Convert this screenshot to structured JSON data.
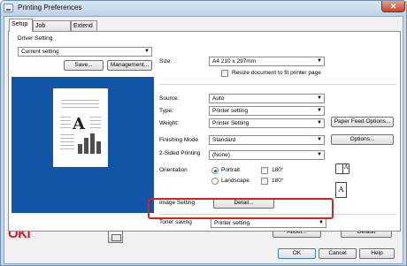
{
  "window": {
    "title": "Printing Preferences",
    "close_glyph": "✕"
  },
  "tabs": [
    {
      "label": "Setup",
      "active": true
    },
    {
      "label": "Job Options",
      "active": false
    },
    {
      "label": "Extend",
      "active": false
    }
  ],
  "driver_setting": {
    "label": "Driver Setting",
    "value": "Current setting",
    "save_label": "Save...",
    "management_label": "Management..."
  },
  "preview": {
    "letter": "A",
    "background_color": "#1155a6",
    "bar_heights": [
      0.45,
      0.75,
      0.95,
      0.6
    ]
  },
  "size": {
    "label": "Size:",
    "value": "A4 210 x 297mm",
    "resize_label": "Resize document to fit printer page",
    "resize_checked": false
  },
  "source": {
    "label": "Source:",
    "value": "Auto"
  },
  "type": {
    "label": "Type:",
    "value": "Printer setting"
  },
  "weight": {
    "label": "Weight:",
    "value": "Printer Setting"
  },
  "paper_feed_options_label": "Paper Feed Options...",
  "finishing_mode": {
    "label": "Finishing Mode",
    "value": "Standard",
    "options_label": "Options..."
  },
  "two_sided": {
    "label": "2-Sided Printing",
    "value": "(None)"
  },
  "orientation": {
    "label": "Orientation",
    "portrait_label": "Portrait",
    "landscape_label": "Landscape",
    "selected": "Portrait",
    "rotate_label": "180°",
    "rotate_portrait_checked": false,
    "rotate_landscape_checked": false,
    "icon_letter": "A"
  },
  "image_setting": {
    "label": "Image Setting",
    "detail_label": "Detail..."
  },
  "toner_saving": {
    "label": "Toner saving",
    "value": "Printer setting",
    "highlight_color": "#d92020"
  },
  "footer": {
    "logo_text": "OKI",
    "logo_color": "#e0141a",
    "about_label": "About...",
    "default_label": "Default",
    "ok_label": "OK",
    "cancel_label": "Cancel",
    "help_label": "Help"
  },
  "icons": {
    "combo_arrow": "▼",
    "app": "printer-preferences-icon",
    "tray": "paper-tray-icon",
    "booklet": "booklet-icon",
    "orientation": "portrait-page-icon"
  }
}
